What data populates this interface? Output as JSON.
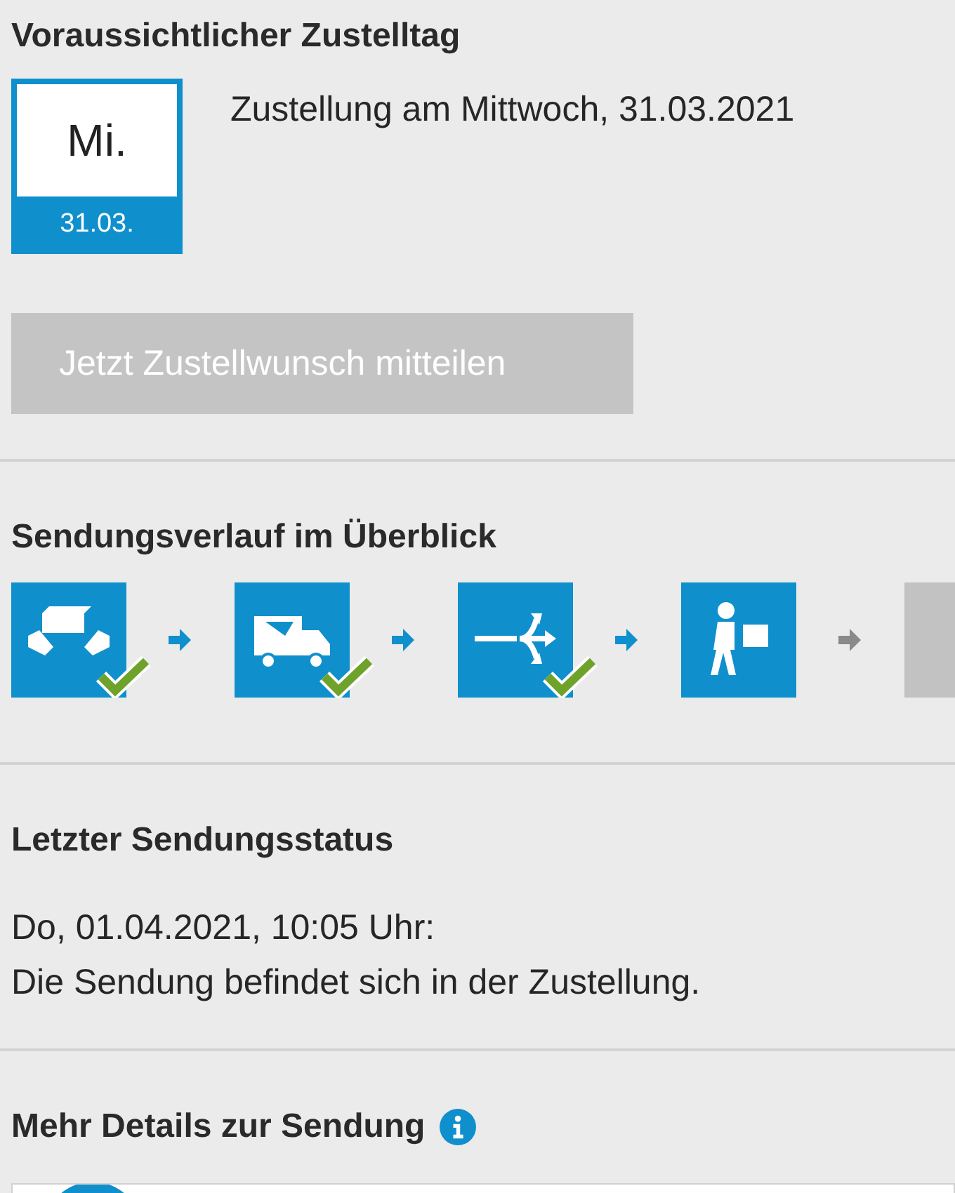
{
  "delivery_day": {
    "heading": "Voraussichtlicher Zustelltag",
    "weekday": "Mi.",
    "date": "31.03.",
    "text": "Zustellung am Mittwoch, 31.03.2021"
  },
  "wish_button": {
    "label": "Jetzt Zustellwunsch mitteilen",
    "disabled": true
  },
  "progress": {
    "heading": "Sendungsverlauf im Überblick",
    "steps": [
      {
        "kind": "handover",
        "reached": true,
        "done": true
      },
      {
        "kind": "truck",
        "reached": true,
        "done": true
      },
      {
        "kind": "hub",
        "reached": true,
        "done": true
      },
      {
        "kind": "courier",
        "reached": true,
        "done": false
      },
      {
        "kind": "delivered",
        "reached": false
      }
    ]
  },
  "status": {
    "heading": "Letzter Sendungsstatus",
    "time": "Do, 01.04.2021, 10:05 Uhr:",
    "text": "Die Sendung befindet sich in der Zustellung."
  },
  "details": {
    "heading": "Mehr Details zur Sendung"
  }
}
